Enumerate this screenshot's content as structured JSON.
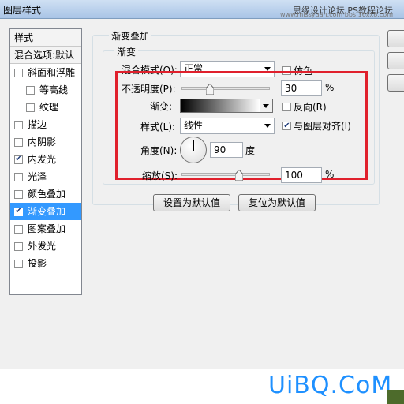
{
  "window": {
    "title": "图层样式"
  },
  "watermark": {
    "line1": "思缘设计论坛 PS教程论坛",
    "line2": "www.missyuan.com  bbs.16xx8.com",
    "brand": "UiBQ.CoM"
  },
  "style_list": {
    "header": "样式",
    "blend_options": "混合选项:默认",
    "items": [
      {
        "label": "斜面和浮雕",
        "checked": false
      },
      {
        "label": "等高线",
        "checked": false
      },
      {
        "label": "纹理",
        "checked": false
      },
      {
        "label": "描边",
        "checked": false
      },
      {
        "label": "内阴影",
        "checked": false
      },
      {
        "label": "内发光",
        "checked": true
      },
      {
        "label": "光泽",
        "checked": false
      },
      {
        "label": "颜色叠加",
        "checked": false
      },
      {
        "label": "渐变叠加",
        "checked": true,
        "selected": true
      },
      {
        "label": "图案叠加",
        "checked": false
      },
      {
        "label": "外发光",
        "checked": false
      },
      {
        "label": "投影",
        "checked": false
      }
    ]
  },
  "panel": {
    "group_title": "渐变叠加",
    "sub_group_title": "渐变",
    "blend_mode": {
      "label": "混合模式(O):",
      "value": "正常"
    },
    "dither": {
      "label": "仿色",
      "checked": false
    },
    "opacity": {
      "label": "不透明度(P):",
      "value": "30",
      "unit": "%",
      "level": 0.3
    },
    "gradient": {
      "label": "渐变:"
    },
    "reverse": {
      "label": "反向(R)",
      "checked": false
    },
    "style": {
      "label": "样式(L):",
      "value": "线性"
    },
    "align": {
      "label": "与图层对齐(I)",
      "checked": true
    },
    "angle": {
      "label": "角度(N):",
      "value": "90",
      "unit": "度"
    },
    "scale": {
      "label": "缩放(S):",
      "value": "100",
      "unit": "%",
      "level": 0.67
    }
  },
  "buttons": {
    "set_default": "设置为默认值",
    "reset_default": "复位为默认值"
  },
  "colors": {
    "highlight": "#e0202c",
    "selection": "#3399ff",
    "brand": "#1e90ff"
  }
}
